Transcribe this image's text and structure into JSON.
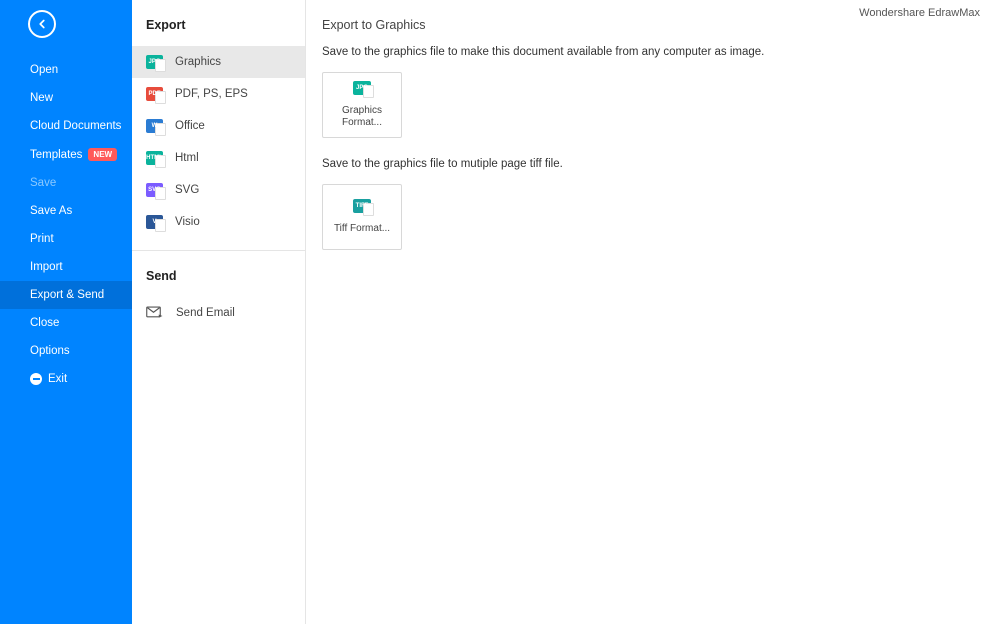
{
  "brand": "Wondershare EdrawMax",
  "sidebar": {
    "items": [
      {
        "label": "Open"
      },
      {
        "label": "New"
      },
      {
        "label": "Cloud Documents"
      },
      {
        "label": "Templates",
        "badge": "NEW"
      },
      {
        "label": "Save",
        "disabled": true
      },
      {
        "label": "Save As"
      },
      {
        "label": "Print"
      },
      {
        "label": "Import"
      },
      {
        "label": "Export & Send",
        "active": true
      },
      {
        "label": "Close"
      },
      {
        "label": "Options"
      },
      {
        "label": "Exit",
        "icon": "exit"
      }
    ]
  },
  "middle": {
    "exportTitle": "Export",
    "exportItems": [
      {
        "label": "Graphics",
        "iconText": "JPG",
        "iconClass": "ic-jpg",
        "selected": true
      },
      {
        "label": "PDF, PS, EPS",
        "iconText": "PDF",
        "iconClass": "ic-pdf"
      },
      {
        "label": "Office",
        "iconText": "W",
        "iconClass": "ic-office"
      },
      {
        "label": "Html",
        "iconText": "HTML",
        "iconClass": "ic-html"
      },
      {
        "label": "SVG",
        "iconText": "SVG",
        "iconClass": "ic-svg"
      },
      {
        "label": "Visio",
        "iconText": "V",
        "iconClass": "ic-visio"
      }
    ],
    "sendTitle": "Send",
    "sendItems": [
      {
        "label": "Send Email"
      }
    ]
  },
  "content": {
    "title": "Export to Graphics",
    "section1": {
      "desc": "Save to the graphics file to make this document available from any computer as image.",
      "tileLabel": "Graphics Format...",
      "iconText": "JPG",
      "iconClass": "ic-jpg"
    },
    "section2": {
      "desc": "Save to the graphics file to mutiple page tiff file.",
      "tileLabel": "Tiff Format...",
      "iconText": "TIFF",
      "iconClass": "ic-tiff"
    }
  }
}
